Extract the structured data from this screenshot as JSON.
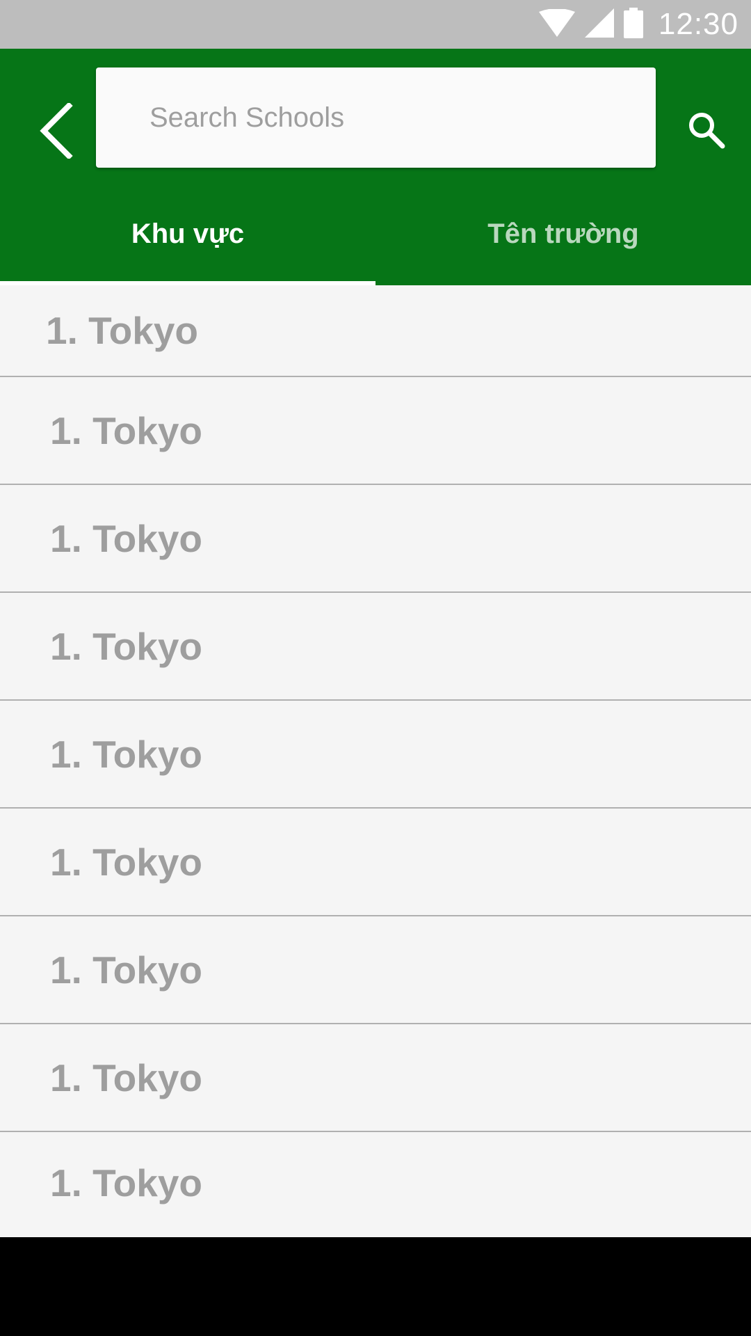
{
  "status_bar": {
    "time": "12:30",
    "icons": [
      "wifi-icon",
      "signal-icon",
      "battery-icon"
    ]
  },
  "header": {
    "search": {
      "placeholder": "Search Schools",
      "value": ""
    },
    "icons": {
      "back": "chevron-left-icon",
      "search": "search-icon"
    }
  },
  "tabs": [
    {
      "label": "Khu vực",
      "active": true
    },
    {
      "label": "Tên trường",
      "active": false
    }
  ],
  "list": {
    "items": [
      {
        "label": "1. Tokyo"
      },
      {
        "label": "1. Tokyo"
      },
      {
        "label": "1. Tokyo"
      },
      {
        "label": "1. Tokyo"
      },
      {
        "label": "1. Tokyo"
      },
      {
        "label": "1. Tokyo"
      },
      {
        "label": "1. Tokyo"
      },
      {
        "label": "1. Tokyo"
      },
      {
        "label": "1. Tokyo"
      }
    ]
  },
  "colors": {
    "app_bar": "#067517",
    "status_bar": "#bdbdbd",
    "list_background": "#f5f5f5",
    "list_text": "#9e9e9e"
  }
}
